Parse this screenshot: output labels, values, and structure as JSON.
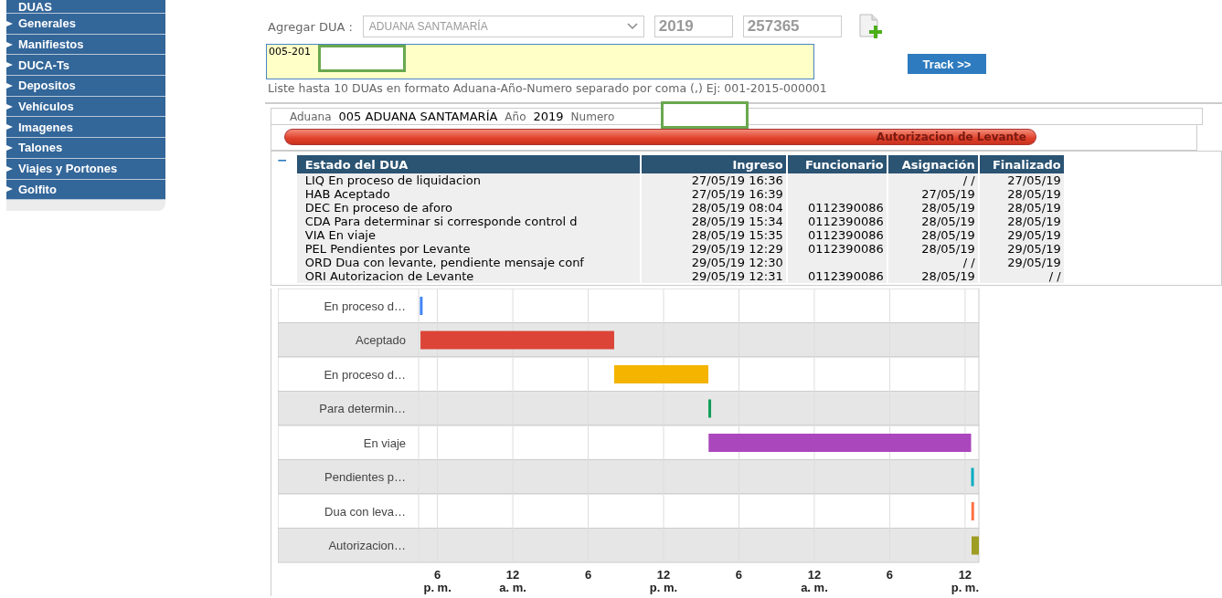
{
  "sidebar": {
    "items": [
      {
        "label": "DUAS",
        "kind": "header"
      },
      {
        "label": "Generales",
        "kind": "link"
      },
      {
        "label": "Manifiestos",
        "kind": "link"
      },
      {
        "label": "DUCA-Ts",
        "kind": "link"
      },
      {
        "label": "Depositos",
        "kind": "link"
      },
      {
        "label": "Vehículos",
        "kind": "link"
      },
      {
        "label": "Imagenes",
        "kind": "link"
      },
      {
        "label": "Talones",
        "kind": "link"
      },
      {
        "label": "Viajes y Portones",
        "kind": "link"
      },
      {
        "label": "Golfito",
        "kind": "link"
      }
    ]
  },
  "add_form": {
    "label": "Agregar DUA :",
    "customs_select": {
      "value": "ADUANA SANTAMARÍA"
    },
    "year_field": {
      "value": "2019"
    },
    "number_field": {
      "value": "257365"
    },
    "list_field": {
      "value": "005-201"
    },
    "track_button": "Track >>",
    "hint": "Liste hasta 10 DUAs en formato Aduana-Año-Numero separado por coma (,) Ej: 001-2015-000001"
  },
  "dua_info": {
    "customs_label": "Aduana",
    "customs_value": "005  ADUANA SANTAMARÍA",
    "year_label": "Año",
    "year_value": "2019",
    "number_label": "Numero"
  },
  "status_bar": {
    "label": "Autorizacion de Levante",
    "collapse": "−"
  },
  "table": {
    "columns": [
      "Estado del DUA",
      "Ingreso",
      "Funcionario",
      "Asignación",
      "Finalizado"
    ],
    "rows": [
      [
        "LIQ En proceso de liquidacion",
        "27/05/19 16:36",
        "",
        "/ /",
        "27/05/19"
      ],
      [
        "HAB Aceptado",
        "27/05/19 16:39",
        "",
        "27/05/19",
        "28/05/19"
      ],
      [
        "DEC En proceso de aforo",
        "28/05/19 08:04",
        "0112390086",
        "28/05/19",
        "28/05/19"
      ],
      [
        "CDA Para determinar si corresponde control d",
        "28/05/19 15:34",
        "0112390086",
        "28/05/19",
        "28/05/19"
      ],
      [
        "VIA En viaje",
        "28/05/19 15:35",
        "0112390086",
        "28/05/19",
        "29/05/19"
      ],
      [
        "PEL Pendientes por Levante",
        "29/05/19 12:29",
        "0112390086",
        "28/05/19",
        "29/05/19"
      ],
      [
        "ORD Dua con levante, pendiente mensaje conf",
        "29/05/19 12:30",
        "",
        "/ /",
        "29/05/19"
      ],
      [
        "ORI Autorizacion de Levante",
        "29/05/19 12:31",
        "0112390086",
        "28/05/19",
        "/ /"
      ]
    ]
  },
  "timeline": {
    "axis_labels": [
      "6\np. m.",
      "12\na. m.",
      "6",
      "12\np. m.",
      "6",
      "12\na. m.",
      "6",
      "12\np. m."
    ],
    "rows": [
      {
        "label": "En proceso d…",
        "color": "#4285f4"
      },
      {
        "label": "Aceptado",
        "color": "#db4437"
      },
      {
        "label": "En proceso d…",
        "color": "#f4b400"
      },
      {
        "label": "Para determin…",
        "color": "#0f9d58"
      },
      {
        "label": "En viaje",
        "color": "#ab47bc"
      },
      {
        "label": "Pendientes p…",
        "color": "#00acc1"
      },
      {
        "label": "Dua con leva…",
        "color": "#ff7043"
      },
      {
        "label": "Autorizacion…",
        "color": "#9e9d24"
      }
    ]
  }
}
